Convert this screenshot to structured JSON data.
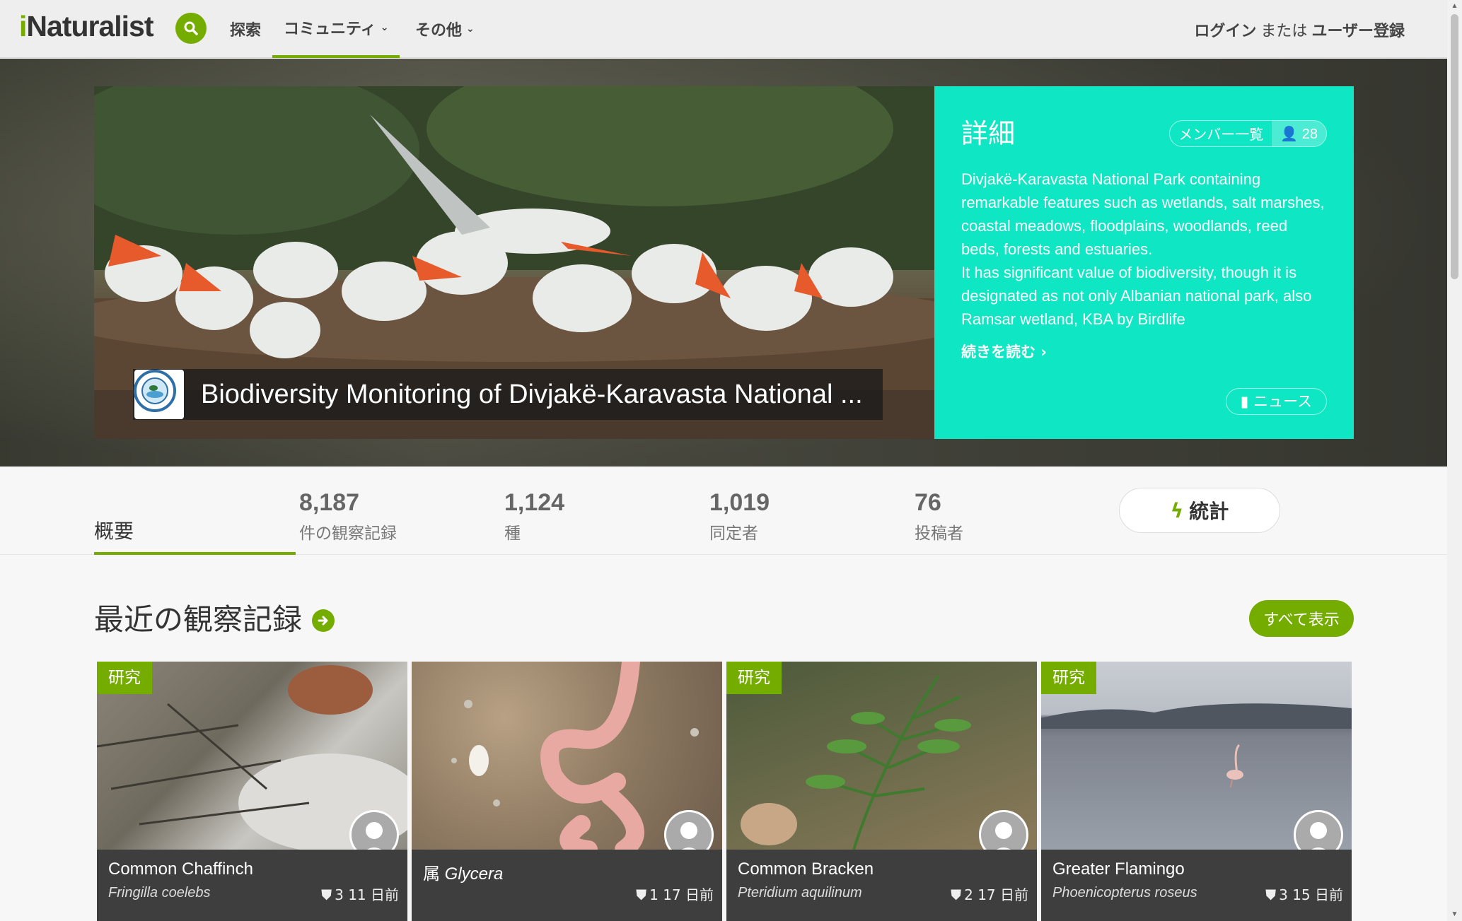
{
  "header": {
    "logo_first": "i",
    "logo_rest": "Naturalist",
    "nav": [
      {
        "label": "探索"
      },
      {
        "label": "コミュニティ"
      },
      {
        "label": "その他"
      }
    ],
    "login_label": "ログイン",
    "or_label": "または",
    "signup_label": "ユーザー登録"
  },
  "hero": {
    "project_title": "Biodiversity Monitoring of Divjakë-Karavasta National ...",
    "details_title": "詳細",
    "members_label": "メンバー一覧",
    "members_count": "28",
    "description": "Divjakë-Karavasta National Park containing remarkable features such as wetlands, salt marshes, coastal meadows, floodplains, woodlands, reed beds, forests and estuaries.\nIt has significant value of biodiversity, though it is designated as not only Albanian national park, also Ramsar wetland, KBA by Birdlife",
    "read_more": "続きを読む ›",
    "news_label": "ニュース"
  },
  "stats": {
    "overview_tab": "概要",
    "items": [
      {
        "value": "8,187",
        "label": "件の観察記録"
      },
      {
        "value": "1,124",
        "label": "種"
      },
      {
        "value": "1,019",
        "label": "同定者"
      },
      {
        "value": "76",
        "label": "投稿者"
      }
    ],
    "stats_button": "統計"
  },
  "recent": {
    "title": "最近の観察記録",
    "show_all": "すべて表示",
    "cards": [
      {
        "badge": "研究",
        "common": "Common Chaffinch",
        "rank": "",
        "sci": "Fringilla coelebs",
        "ids": "3",
        "age": "11 日前"
      },
      {
        "badge": "",
        "common": "",
        "rank": "属",
        "sci": "Glycera",
        "ids": "1",
        "age": "17 日前"
      },
      {
        "badge": "研究",
        "common": "Common Bracken",
        "rank": "",
        "sci": "Pteridium aquilinum",
        "ids": "2",
        "age": "17 日前"
      },
      {
        "badge": "研究",
        "common": "Greater Flamingo",
        "rank": "",
        "sci": "Phoenicopterus roseus",
        "ids": "3",
        "age": "15 日前"
      }
    ]
  },
  "colors": {
    "brand_green": "#74ac00",
    "details_teal": "#0fe6c4"
  },
  "icons": [
    "search-icon",
    "chevron-down-icon",
    "user-icon",
    "book-icon",
    "bolt-icon",
    "arrow-right-icon",
    "identification-icon"
  ]
}
